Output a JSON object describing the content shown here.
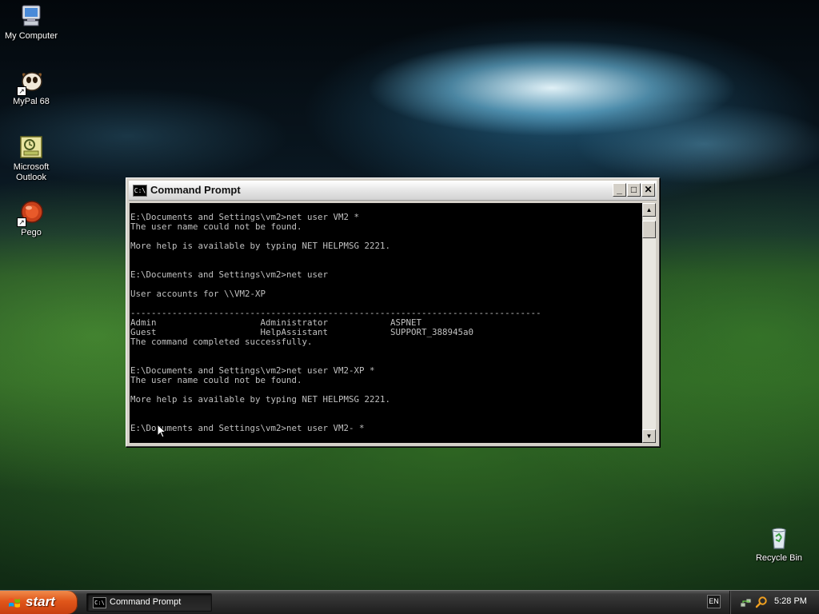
{
  "desktop": {
    "icons": [
      {
        "label": "My Computer",
        "icon": "my-computer-icon"
      },
      {
        "label": "MyPal 68",
        "icon": "mypal-browser-icon"
      },
      {
        "label": "Microsoft Outlook",
        "icon": "outlook-icon"
      },
      {
        "label": "Pego",
        "icon": "pego-icon"
      },
      {
        "label": "Recycle Bin",
        "icon": "recycle-bin-icon"
      }
    ]
  },
  "window": {
    "title": "Command Prompt",
    "icon_text": "C:\\",
    "controls": {
      "minimize": "_",
      "maximize": "□",
      "close": "✕"
    },
    "scroll": {
      "up": "▲",
      "down": "▼"
    }
  },
  "console": {
    "lines": [
      "",
      "E:\\Documents and Settings\\vm2>net user VM2 *",
      "The user name could not be found.",
      "",
      "More help is available by typing NET HELPMSG 2221.",
      "",
      "",
      "E:\\Documents and Settings\\vm2>net user",
      "",
      "User accounts for \\\\VM2-XP",
      "",
      "-------------------------------------------------------------------------------",
      "Admin                    Administrator            ASPNET",
      "Guest                    HelpAssistant            SUPPORT_388945a0",
      "The command completed successfully.",
      "",
      "",
      "E:\\Documents and Settings\\vm2>net user VM2-XP *",
      "The user name could not be found.",
      "",
      "More help is available by typing NET HELPMSG 2221.",
      "",
      "",
      "E:\\Documents and Settings\\vm2>net user VM2- *"
    ]
  },
  "taskbar": {
    "start_label": "start",
    "tasks": [
      {
        "label": "Command Prompt",
        "icon_text": "C:\\"
      }
    ],
    "language": "EN",
    "clock": "5:28 PM"
  },
  "colors": {
    "start_button": "#e0561a",
    "console_bg": "#000000",
    "console_text": "#c0c0c0"
  }
}
